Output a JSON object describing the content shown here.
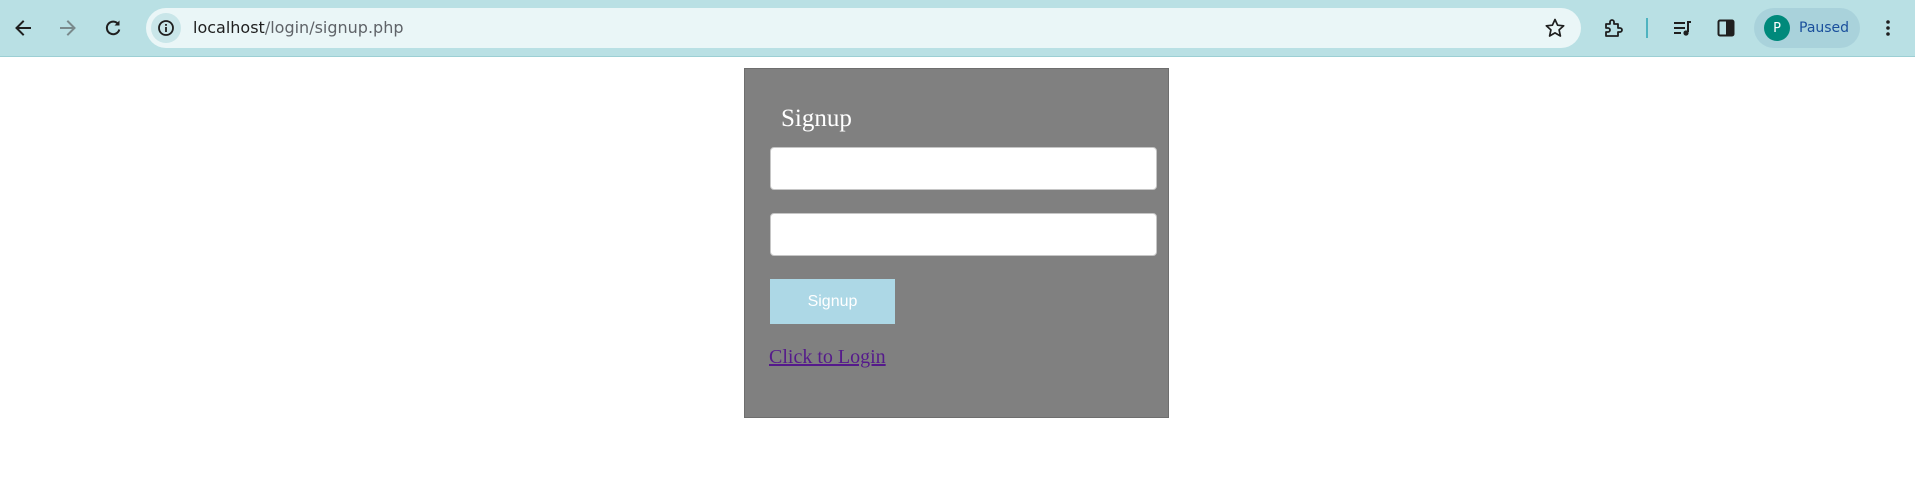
{
  "browser": {
    "url_host": "localhost",
    "url_path": "/login/signup.php",
    "profile_initial": "P",
    "profile_status": "Paused",
    "icons": [
      "back-arrow-icon",
      "forward-arrow-icon",
      "reload-icon",
      "site-info-icon",
      "bookmark-star-icon",
      "extensions-icon",
      "media-queue-icon",
      "side-panel-icon",
      "menu-dots-icon"
    ],
    "colors": {
      "toolbar": "#b9e0e4",
      "omnibox": "#eaf6f7",
      "avatar": "#00897b"
    }
  },
  "form": {
    "heading": "Signup",
    "username_value": "",
    "password_value": "",
    "submit_label": "Signup",
    "login_link": "Click to Login",
    "colors": {
      "panel": "#808080",
      "button": "#add8e6",
      "link": "#551a8b"
    }
  }
}
